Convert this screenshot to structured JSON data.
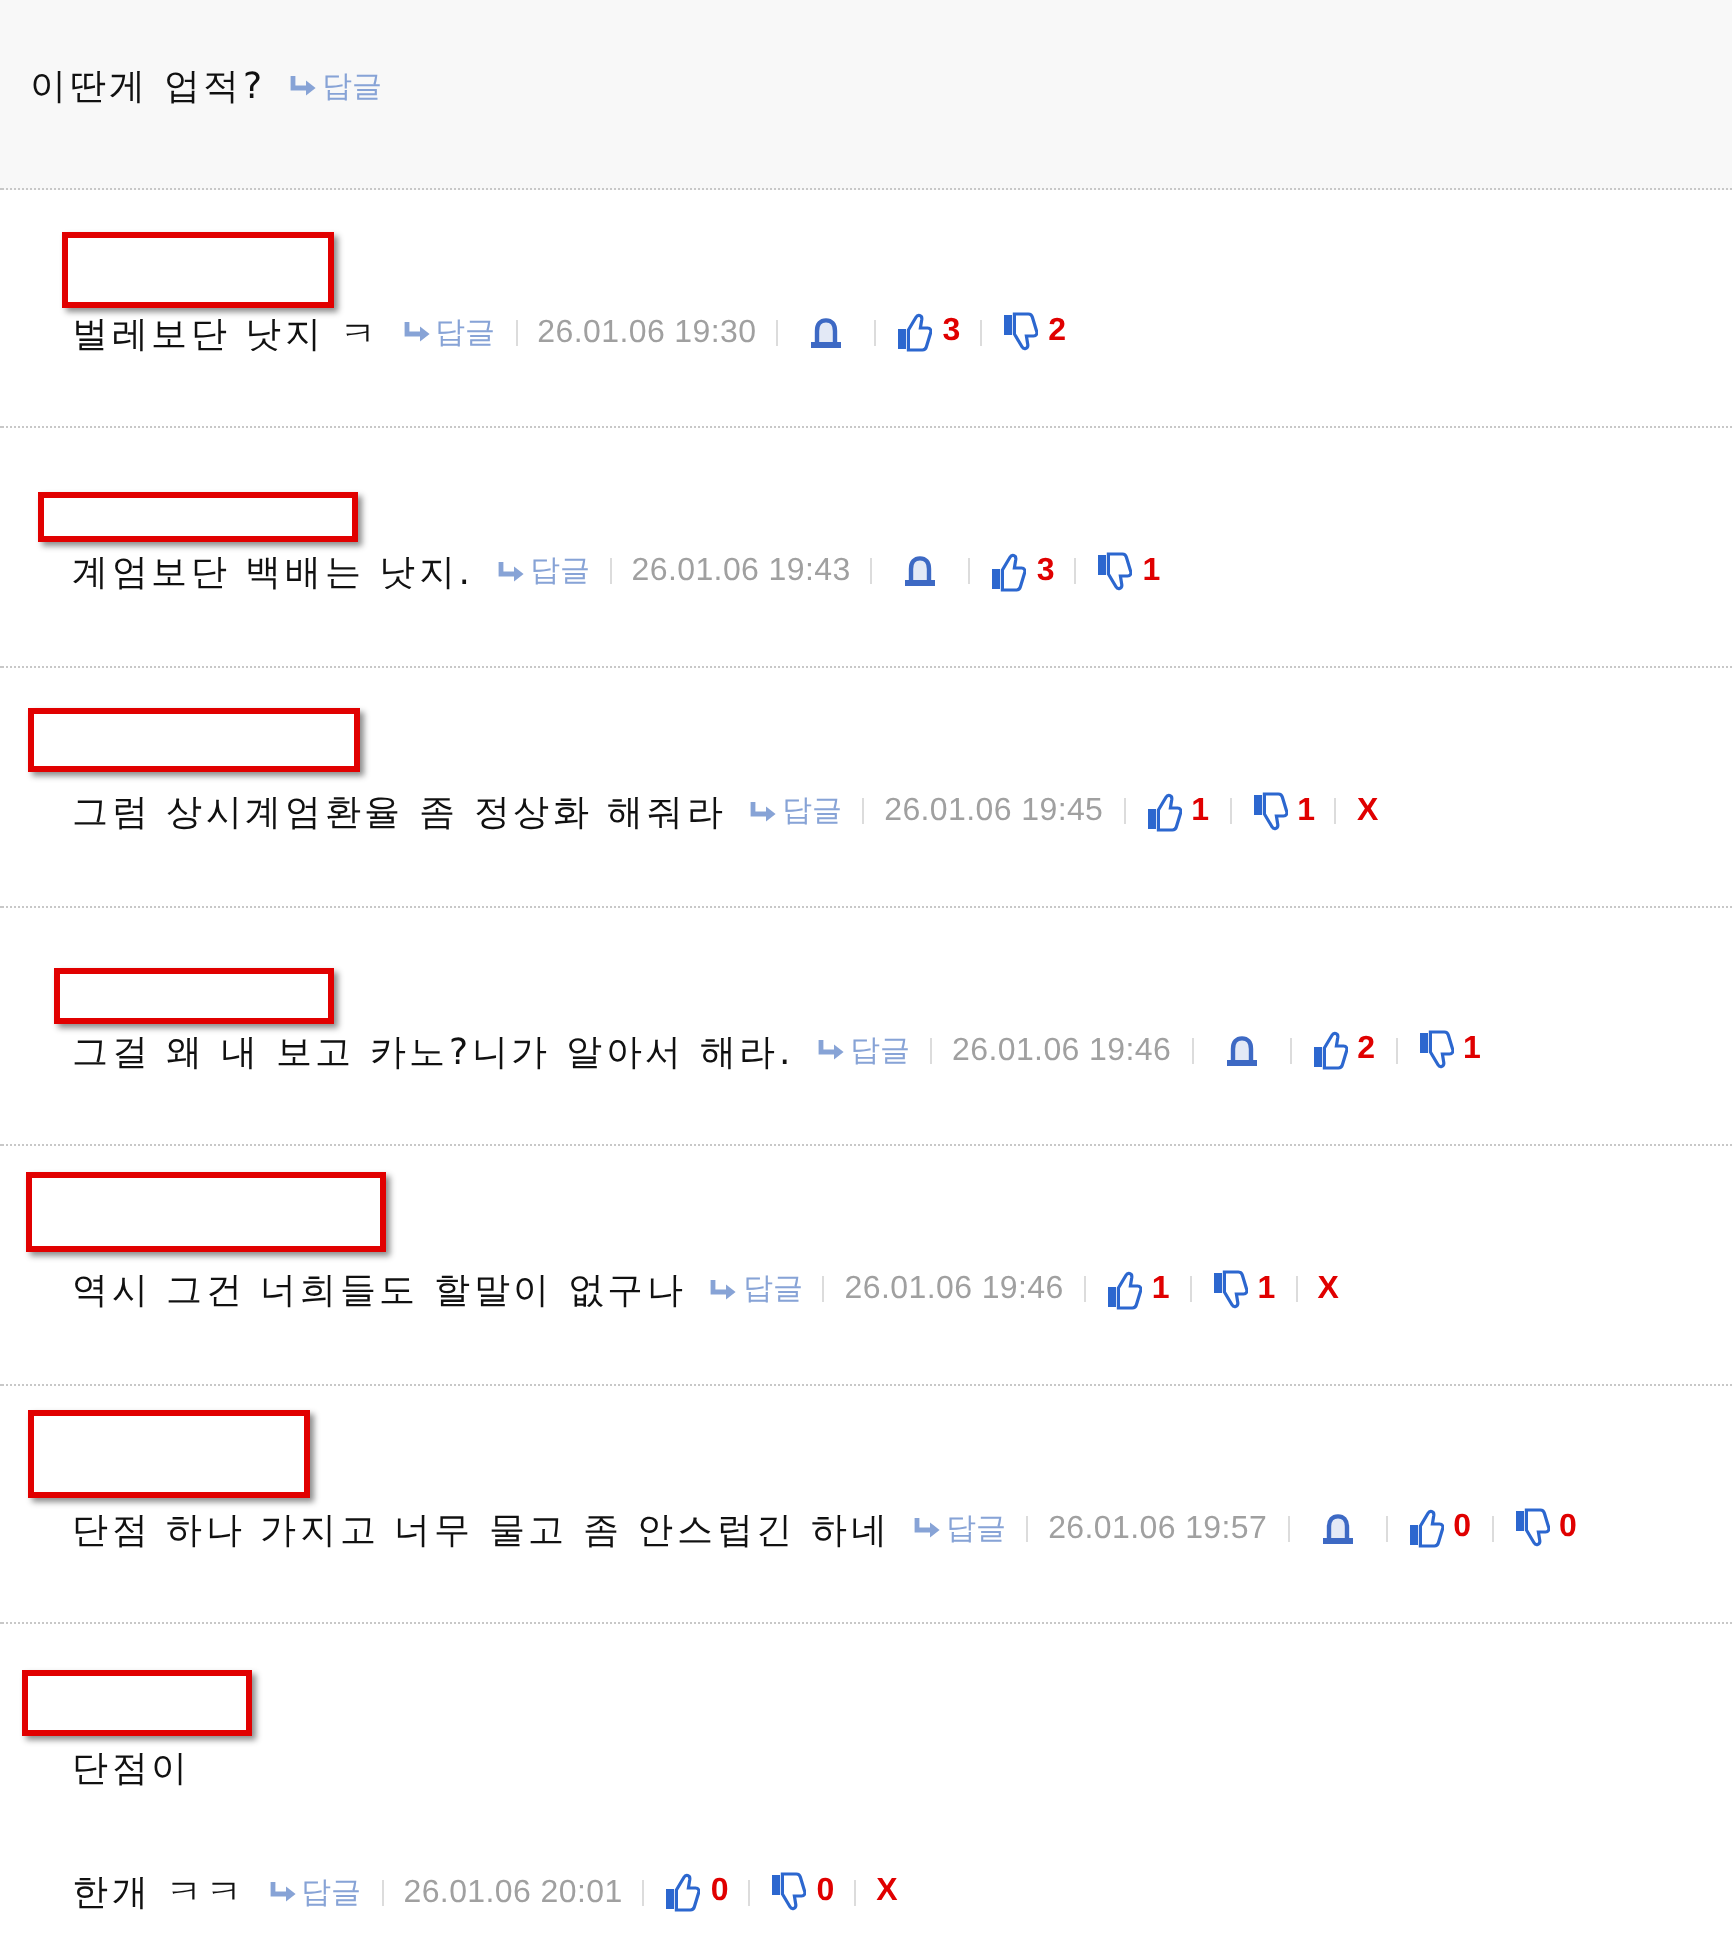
{
  "post": {
    "text": "이딴게 업적?",
    "reply_label": "답글"
  },
  "comments": [
    {
      "name_redacted": true,
      "text": "벌레보단 낫지 ㅋ",
      "reply_label": "답글",
      "date": "26.01.06 19:30",
      "report_button": true,
      "likes": "3",
      "dislikes": "2"
    },
    {
      "name_redacted": true,
      "text": "계엄보단 백배는 낫지.",
      "reply_label": "답글",
      "date": "26.01.06 19:43",
      "report_button": true,
      "likes": "3",
      "dislikes": "1"
    },
    {
      "name_redacted": true,
      "text": "그럼 상시계엄환율 좀 정상화 해줘라",
      "reply_label": "답글",
      "date": "26.01.06 19:45",
      "report_button": false,
      "likes": "1",
      "dislikes": "1",
      "delete_label": "X"
    },
    {
      "name_redacted": true,
      "text": "그걸 왜 내 보고 카노?니가 알아서 해라.",
      "reply_label": "답글",
      "date": "26.01.06 19:46",
      "report_button": true,
      "likes": "2",
      "dislikes": "1"
    },
    {
      "name_redacted": true,
      "text": "역시 그건 너희들도 할말이 없구나",
      "reply_label": "답글",
      "date": "26.01.06 19:46",
      "report_button": false,
      "likes": "1",
      "dislikes": "1",
      "delete_label": "X"
    },
    {
      "name_redacted": true,
      "text": "단점 하나 가지고 너무 물고 좀 안스럽긴 하네",
      "reply_label": "답글",
      "date": "26.01.06 19:57",
      "report_button": true,
      "likes": "0",
      "dislikes": "0"
    },
    {
      "name_redacted": true,
      "text": "단점이\n\n한개 ㅋㅋ",
      "reply_label": "답글",
      "date": "26.01.06 20:01",
      "report_button": false,
      "likes": "0",
      "dislikes": "0",
      "delete_label": "X"
    }
  ]
}
